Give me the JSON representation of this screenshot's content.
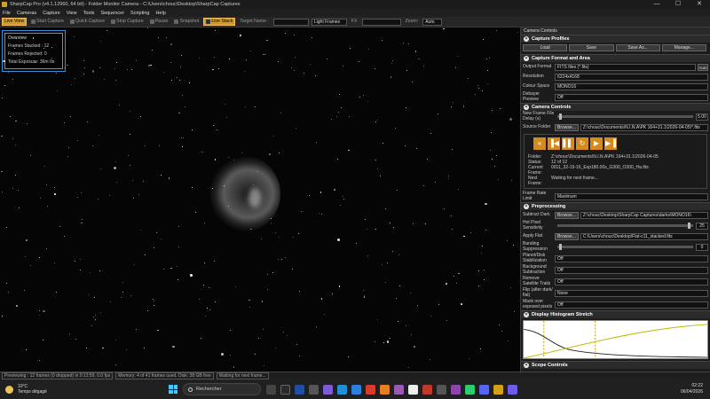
{
  "window": {
    "title": "SharpCap Pro (v4.1.12960, 64 bit) - Folder Monitor Camera - C:\\Users\\chouc\\Desktop\\SharpCap Captures",
    "minimize": "—",
    "maximize": "☐",
    "close": "✕"
  },
  "menu": [
    "File",
    "Cameras",
    "Capture",
    "View",
    "Tools",
    "Sequencer",
    "Scripting",
    "Help"
  ],
  "toolbar": {
    "live_view": "Live View",
    "start_capture": "Start Capture",
    "quick_capture": "Quick Capture",
    "stop_capture": "Stop Capture",
    "pause": "Pause",
    "snapshot": "Snapshot",
    "live_stack": "Live Stack",
    "target_name": "Target Name :",
    "frame_type": "Light Frames",
    "fx": "FX",
    "zoom_label": "Zoom:",
    "zoom_value": "Auto"
  },
  "overview": {
    "title": "Overview",
    "frames_stacked": "Frames Stacked : 12",
    "frames_rejected": "Frames Rejected: 0",
    "total_exposure": "Total Exposure:  36m 0s"
  },
  "panel": {
    "title": "Camera Controls",
    "capture_profiles": {
      "title": "Capture Profiles",
      "buttons": [
        "Load",
        "Save",
        "Save As...",
        "Manage..."
      ]
    },
    "capture_format": {
      "title": "Capture Format and Area",
      "output_format_label": "Output Format",
      "output_format": "FITS files (*.fits)",
      "auto": "Auto",
      "resolution_label": "Resolution",
      "resolution": "6224x4168",
      "colour_space_label": "Colour Space",
      "colour_space": "MONO16",
      "debayer_label": "Debayer Preview",
      "debayer": "Off"
    },
    "camera_controls": {
      "title": "Camera Controls",
      "new_frame_delay_label": "New Frame File Delay (s)",
      "new_frame_delay": "5.00",
      "source_folder_label": "Source Folder",
      "browse": "Browse...",
      "source_folder": "Z:\\chouc\\Documents\\N.I.N.A\\PK 164+31.1\\2026-04-05\\*.fits",
      "info": [
        {
          "k": "Folder:",
          "v": "Z:\\chouc\\Documents\\N.I.N.A\\PK 164+31.1\\2026-04-05"
        },
        {
          "k": "Status:",
          "v": "12 of 12"
        },
        {
          "k": "Current Frame:",
          "v": "0011_32-19-16_Exp180.00s_G300_O300_Ha.fits"
        },
        {
          "k": "Next Frame:",
          "v": "Waiting for next frame..."
        }
      ],
      "frame_rate_label": "Frame Rate Limit",
      "frame_rate": "Maximum"
    },
    "preprocessing": {
      "title": "Preprocessing",
      "subtract_dark_label": "Subtract Dark",
      "subtract_dark": "Z:\\chouc\\Desktop\\SharpCap Captures\\darks\\MONO16\\",
      "hot_pixel_label": "Hot Pixel Sensitivity",
      "hot_pixel": "25",
      "apply_flat_label": "Apply Flat",
      "apply_flat": "C:\\Users\\chouc\\Desktop\\Flat-c11_stacked.fits",
      "banding_label": "Banding Suppression",
      "banding": "0",
      "planet_label": "Planet/Disk Stabilization",
      "planet": "Off",
      "background_label": "Background Subtraction",
      "background": "Off",
      "satellite_label": "Remove Satellite Trails",
      "satellite": "Off",
      "flip_label": "Flip (after dark/ flat)",
      "flip": "None",
      "mask_label": "Mask over exposed pixels",
      "mask": "Off"
    },
    "histogram": {
      "title": "Display Histogram Stretch"
    },
    "scope_controls": {
      "title": "Scope Controls"
    }
  },
  "statusbar": {
    "previewing": "Previewing : 12 frames (0 dropped) in 0:12:59, 0.0 fps",
    "memory": "Memory: 4 of 41 frames used. Disk: 38 GB free",
    "waiting": "Waiting for next frame..."
  },
  "taskbar": {
    "temp": "10°C",
    "weather": "Temps dégagé",
    "search": "Rechercher",
    "time": "02:22",
    "date": "06/04/2026"
  }
}
